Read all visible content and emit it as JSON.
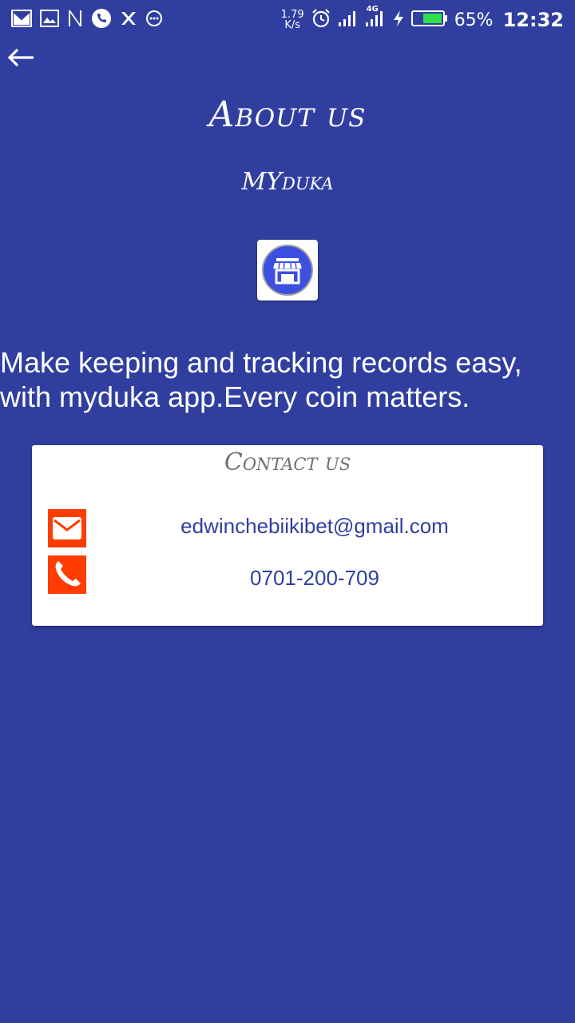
{
  "status_bar": {
    "net_speed_value": "1.79",
    "net_speed_unit": "K/s",
    "network_type": "4G",
    "battery_percent": "65%",
    "time": "12:32"
  },
  "header": {
    "title": "About us",
    "app_name": "MYduka"
  },
  "about": {
    "tagline": "Make keeping and tracking records easy, with myduka app.Every coin matters."
  },
  "contact": {
    "title": "Contact us",
    "email": "edwinchebiikibet@gmail.com",
    "phone": "0701-200-709"
  },
  "colors": {
    "background": "#303f9f",
    "accent": "#ff3d00",
    "logo_circle": "#3d4fe0",
    "card": "#ffffff"
  }
}
